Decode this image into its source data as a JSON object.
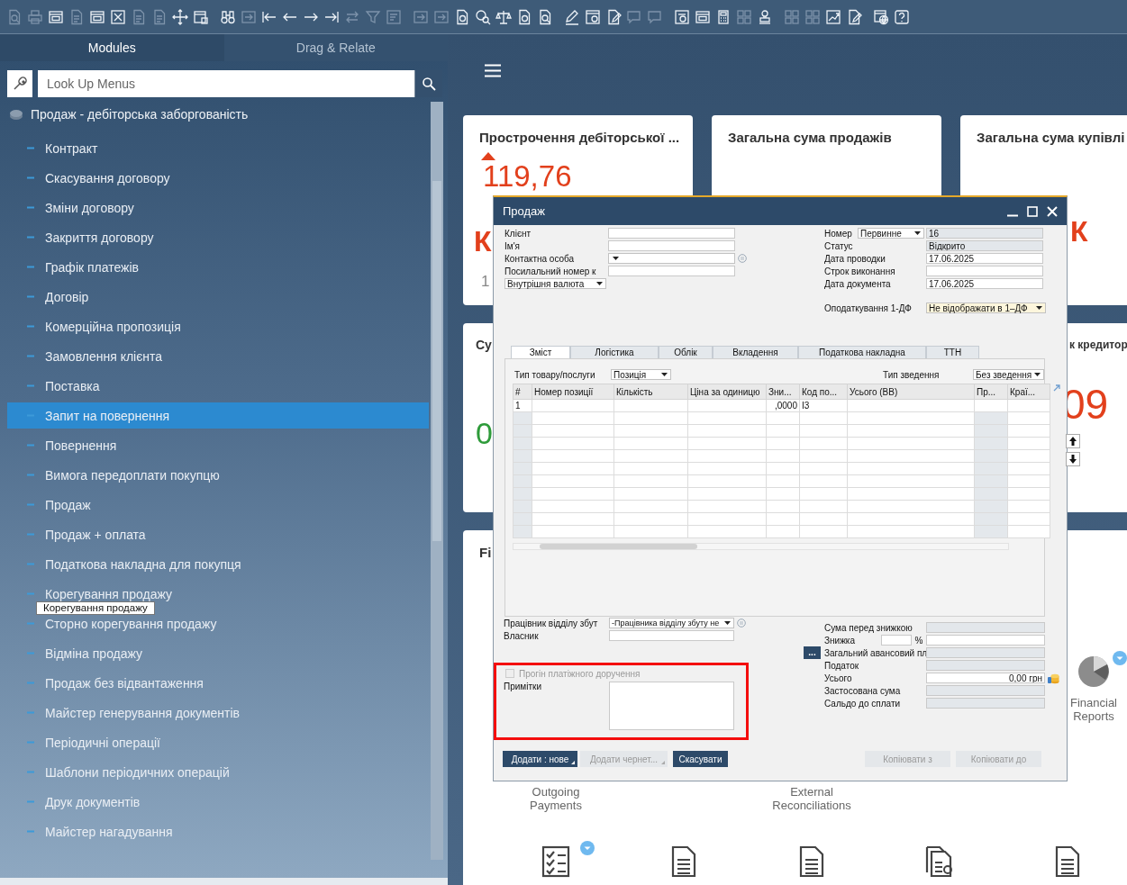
{
  "toolbar": [
    {
      "icons": [
        {
          "kind": "doc-search",
          "disabled": true
        },
        {
          "kind": "printer",
          "disabled": true
        },
        {
          "kind": "window",
          "disabled": false
        },
        {
          "kind": "document",
          "disabled": true
        },
        {
          "kind": "window",
          "disabled": false
        },
        {
          "kind": "box-x",
          "disabled": false
        },
        {
          "kind": "document",
          "disabled": true
        },
        {
          "kind": "document",
          "disabled": true
        },
        {
          "kind": "move",
          "disabled": false
        },
        {
          "kind": "form",
          "disabled": false
        }
      ]
    },
    {
      "icons": [
        {
          "kind": "binoculars",
          "disabled": false
        },
        {
          "kind": "arrow-box",
          "disabled": true
        },
        {
          "kind": "first",
          "disabled": false
        },
        {
          "kind": "prev",
          "disabled": false
        },
        {
          "kind": "next",
          "disabled": false
        },
        {
          "kind": "last",
          "disabled": false
        },
        {
          "kind": "swap",
          "disabled": true
        },
        {
          "kind": "filter",
          "disabled": true
        },
        {
          "kind": "sort",
          "disabled": true
        }
      ]
    },
    {
      "icons": [
        {
          "kind": "arrow-box",
          "disabled": true
        },
        {
          "kind": "arrow-box",
          "disabled": true
        },
        {
          "kind": "doc-coin",
          "disabled": false
        },
        {
          "kind": "coin-search",
          "disabled": false
        },
        {
          "kind": "balance",
          "disabled": false
        },
        {
          "kind": "doc-coin",
          "disabled": false
        },
        {
          "kind": "doc-search",
          "disabled": false
        }
      ]
    },
    {
      "icons": [
        {
          "kind": "pen",
          "disabled": false
        },
        {
          "kind": "gear-doc",
          "disabled": false
        },
        {
          "kind": "pen-doc",
          "disabled": false
        },
        {
          "kind": "message",
          "disabled": true
        },
        {
          "kind": "message",
          "disabled": true
        }
      ]
    },
    {
      "icons": [
        {
          "kind": "info-doc",
          "disabled": false
        },
        {
          "kind": "window",
          "disabled": false
        },
        {
          "kind": "calculator",
          "disabled": false
        },
        {
          "kind": "tiles",
          "disabled": true
        },
        {
          "kind": "stamp",
          "disabled": false
        }
      ]
    },
    {
      "icons": [
        {
          "kind": "tiles",
          "disabled": true
        },
        {
          "kind": "tiles",
          "disabled": true
        },
        {
          "kind": "chart",
          "disabled": false
        },
        {
          "kind": "pen-doc",
          "disabled": false
        }
      ]
    },
    {
      "icons": [
        {
          "kind": "globe",
          "disabled": false
        },
        {
          "kind": "help",
          "disabled": false
        }
      ]
    }
  ],
  "sidebar": {
    "tabs": [
      {
        "label": "Modules",
        "selected": true
      },
      {
        "label": "Drag & Relate",
        "selected": false
      }
    ],
    "search": {
      "placeholder": "Look Up Menus"
    },
    "module": "Продаж - дебіторська заборгованість",
    "items": [
      {
        "label": "Контракт",
        "selected": false
      },
      {
        "label": "Скасування договору",
        "selected": false
      },
      {
        "label": "Зміни договору",
        "selected": false
      },
      {
        "label": "Закриття договору",
        "selected": false
      },
      {
        "label": "Графік платежів",
        "selected": false
      },
      {
        "label": "Договір",
        "selected": false
      },
      {
        "label": "Комерційна пропозиція",
        "selected": false
      },
      {
        "label": "Замовлення клієнта",
        "selected": false
      },
      {
        "label": "Поставка",
        "selected": false
      },
      {
        "label": "Запит на повернення",
        "selected": true
      },
      {
        "label": "Повернення",
        "selected": false
      },
      {
        "label": "Вимога передоплати покупцю",
        "selected": false
      },
      {
        "label": "Продаж",
        "selected": false
      },
      {
        "label": "Продаж + оплата",
        "selected": false
      },
      {
        "label": "Податкова накладна для покупця",
        "selected": false
      },
      {
        "label": "Корегування продажу",
        "selected": false
      },
      {
        "label": "Сторно корегування продажу",
        "selected": false
      },
      {
        "label": "Відміна продажу",
        "selected": false
      },
      {
        "label": "Продаж без відвантаження",
        "selected": false
      },
      {
        "label": "Майстер генерування документів",
        "selected": false
      },
      {
        "label": "Періодичні операції",
        "selected": false
      },
      {
        "label": "Шаблони періодичних операцій",
        "selected": false
      },
      {
        "label": "Друк документів",
        "selected": false
      },
      {
        "label": "Майстер нагадування",
        "selected": false
      }
    ],
    "tooltip": "Корегування продажу"
  },
  "dashboard": {
    "cards": [
      {
        "title": "Прострочення дебіторської ...",
        "kind": "rising",
        "lines": [
          {
            "kind": "big-red",
            "text": "119,76"
          },
          {
            "kind": "red",
            "text": "К"
          },
          {
            "kind": "note",
            "text": "1"
          }
        ]
      },
      {
        "title": "Загальна сума продажів"
      },
      {
        "title": "Загальна сума купівлі",
        "lines": [
          {
            "kind": "red",
            "text": "К"
          }
        ]
      },
      {
        "title": "Су",
        "lines": [
          {
            "kind": "big-green",
            "text": "0"
          }
        ]
      },
      {
        "title": "к кредитор",
        "lines": [
          {
            "kind": "big-red",
            "text": "09"
          }
        ]
      }
    ],
    "panel": {
      "title": "Fi",
      "tiles": [
        {
          "label": "Financial Reports",
          "kind": "chart",
          "badge": true
        },
        {
          "label": "Outgoing Payments",
          "kind": "label"
        },
        {
          "label": "External Reconciliations",
          "kind": "label"
        }
      ],
      "icons": [
        {
          "kind": "checklist",
          "badge": true
        },
        {
          "kind": "document",
          "badge": false
        },
        {
          "kind": "document",
          "badge": false
        },
        {
          "kind": "document-coin",
          "badge": false
        },
        {
          "kind": "document",
          "badge": false
        }
      ]
    }
  },
  "dialog": {
    "title": "Продаж",
    "header_left": [
      {
        "label": "Клієнт",
        "kind": "field"
      },
      {
        "label": "Ім'я",
        "kind": "field"
      },
      {
        "label": "Контактна особа",
        "kind": "dropdown-info"
      },
      {
        "label": "Посилальний номер к",
        "kind": "field"
      }
    ],
    "currency": "Внутрішня валюта",
    "header_right": [
      {
        "label": "Номер",
        "kind": "series",
        "series": "Первинне",
        "value": "16"
      },
      {
        "label": "Статус",
        "kind": "readonly",
        "value": "Відкрито"
      },
      {
        "label": "Дата проводки",
        "kind": "field",
        "value": "17.06.2025"
      },
      {
        "label": "Строк виконання",
        "kind": "field"
      },
      {
        "label": "Дата документа",
        "kind": "field",
        "value": "17.06.2025"
      }
    ],
    "tax": {
      "label": "Оподаткування 1-ДФ",
      "value": "Не відображати в 1–ДФ"
    },
    "tabs": [
      {
        "label": "Зміст",
        "selected": true
      },
      {
        "label": "Логістика",
        "selected": false
      },
      {
        "label": "Облік",
        "selected": false
      },
      {
        "label": "Вкладення",
        "selected": false
      },
      {
        "label": "Податкова накладна",
        "selected": false
      },
      {
        "label": "ТТН",
        "selected": false
      }
    ],
    "item_type": {
      "label": "Тип товару/послуги",
      "value": "Позиція"
    },
    "summary_type": {
      "label": "Тип зведення",
      "value": "Без зведення"
    },
    "table": {
      "columns": [
        "#",
        "Номер позиції",
        "Кількість",
        "Ціна за одиницю",
        "Зни...",
        "Код по...",
        "Усього (ВВ)",
        "Пр...",
        "Краї..."
      ],
      "rows": [
        [
          "1",
          null,
          null,
          null,
          ",0000",
          "I3",
          null,
          null,
          null
        ]
      ]
    },
    "footer_left": [
      {
        "label": "Працівник відділу збут",
        "kind": "dropdown-info",
        "value": "-Працівника відділу збуту не"
      },
      {
        "label": "Власник",
        "kind": "field"
      }
    ],
    "notes": {
      "highlighted": true,
      "payment_order": {
        "label": "Прогін платіжного доручення",
        "checked": false,
        "disabled": true
      },
      "remarks": "Примітки"
    },
    "totals": [
      {
        "label": "Сума перед знижкою",
        "kind": "readonly"
      },
      {
        "label": "Знижка",
        "kind": "percent",
        "unit": "%"
      },
      {
        "label": "Загальний авансовий пл",
        "kind": "readonly-button",
        "button": "..."
      },
      {
        "label": "Податок",
        "kind": "readonly"
      },
      {
        "label": "Усього",
        "kind": "total",
        "value": "0,00 грн"
      },
      {
        "label": "Застосована сума",
        "kind": "readonly"
      },
      {
        "label": "Сальдо до сплати",
        "kind": "readonly"
      }
    ],
    "buttons": [
      {
        "label": "Додати : нове",
        "disabled": false,
        "menu": true
      },
      {
        "label": "Додати чернет...",
        "disabled": true,
        "menu": true
      },
      {
        "label": "Скасувати",
        "disabled": false,
        "menu": false
      }
    ],
    "copy_buttons": [
      {
        "label": "Копіювати з",
        "disabled": true
      },
      {
        "label": "Копіювати до",
        "disabled": true
      }
    ]
  }
}
